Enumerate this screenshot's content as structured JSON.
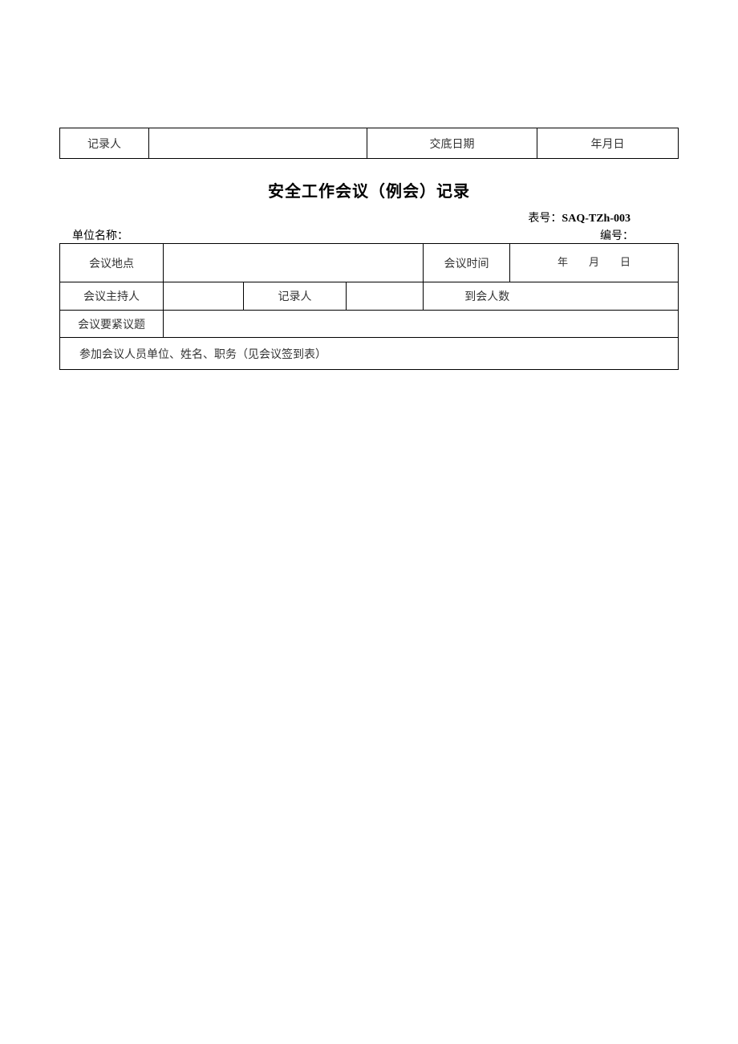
{
  "top_table": {
    "recorder_label": "记录人",
    "recorder_value": "",
    "disclosure_date_label": "交底日期",
    "disclosure_date_value": "年月日"
  },
  "title": "安全工作会议（例会）记录",
  "header": {
    "form_no_label": "表号：",
    "form_no_value": "SAQ-TZh-003",
    "unit_name_label": "单位名称：",
    "serial_no_label": "编号："
  },
  "main": {
    "location_label": "会议地点",
    "location_value": "",
    "time_label": "会议时间",
    "time_value": "年　　月　　日",
    "host_label": "会议主持人",
    "host_value": "",
    "recorder_label": "记录人",
    "recorder_value": "",
    "attendee_count_label": "到会人数",
    "attendee_count_value": "",
    "topic_label": "会议要紧议题",
    "topic_value": "",
    "attendees_note": "参加会议人员单位、姓名、职务（见会议签到表）"
  }
}
